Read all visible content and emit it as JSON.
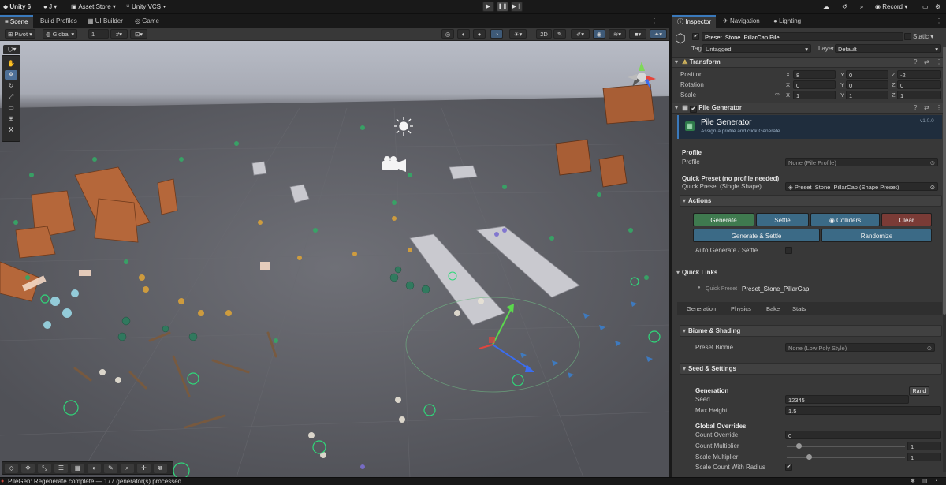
{
  "topbar": {
    "app_menu": "Unity 6",
    "account": "J",
    "asset_store": "Asset Store",
    "vcs": "Unity VCS",
    "record": "Record"
  },
  "scene_tabs": [
    "Scene",
    "Build Profiles",
    "UI Builder",
    "Game"
  ],
  "scene_toolbar": {
    "pivot": "Pivot",
    "space": "Global",
    "snap_value": "1",
    "mode_2d": "2D"
  },
  "inspector_tabs": [
    "Inspector",
    "Navigation",
    "Lighting"
  ],
  "object": {
    "name": "Preset_Stone_PillarCap Pile",
    "static_label": "Static",
    "tag_label": "Tag",
    "tag_value": "Untagged",
    "layer_label": "Layer",
    "layer_value": "Default"
  },
  "transform": {
    "title": "Transform",
    "rows": [
      {
        "label": "Position",
        "x": "8",
        "y": "0",
        "z": "-2"
      },
      {
        "label": "Rotation",
        "x": "0",
        "y": "0",
        "z": "0"
      },
      {
        "label": "Scale",
        "x": "1",
        "y": "1",
        "z": "1"
      }
    ],
    "axis_x": "X",
    "axis_y": "Y",
    "axis_z": "Z"
  },
  "pile_generator": {
    "component_title": "Pile Generator",
    "header_title": "Pile Generator",
    "header_subtitle": "Assign a profile and click Generate",
    "version": "v1.0.0",
    "profile_heading": "Profile",
    "profile_label": "Profile",
    "profile_value": "None (Pile Profile)",
    "quick_preset_heading": "Quick Preset (no profile needed)",
    "quick_preset_label": "Quick Preset (Single Shape)",
    "quick_preset_value": "Preset_Stone_PillarCap (Shape Preset)",
    "actions_title": "Actions",
    "buttons": {
      "generate": "Generate",
      "settle": "Settle",
      "colliders": "Colliders",
      "clear": "Clear",
      "generate_settle": "Generate & Settle",
      "randomize": "Randomize"
    },
    "auto_generate_label": "Auto Generate / Settle",
    "quick_links_title": "Quick Links",
    "quick_link_label": "Quick Preset",
    "quick_link_value": "Preset_Stone_PillarCap",
    "subtabs": [
      "Generation",
      "Physics",
      "Bake",
      "Stats"
    ],
    "biome_title": "Biome & Shading",
    "preset_biome_label": "Preset Biome",
    "preset_biome_value": "None (Low Poly Style)",
    "seed_title": "Seed & Settings",
    "generation_heading": "Generation",
    "rand_button": "Rand",
    "seed_label": "Seed",
    "seed_value": "12345",
    "max_height_label": "Max Height",
    "max_height_value": "1.5",
    "global_overrides_heading": "Global Overrides",
    "count_override_label": "Count Override",
    "count_override_value": "0",
    "count_multiplier_label": "Count Multiplier",
    "count_multiplier_value": "1",
    "scale_multiplier_label": "Scale Multiplier",
    "scale_multiplier_value": "1",
    "scale_count_radius_label": "Scale Count With Radius"
  },
  "status": {
    "text": "PileGen: Regenerate complete — 177 generator(s) processed."
  },
  "colors": {
    "accent_blue": "#3a79bb",
    "generate_green": "#3f7a4f",
    "settle_blue": "#3b6a86",
    "clear_red": "#7a3b36",
    "header_bg": "#1f2d3d"
  }
}
